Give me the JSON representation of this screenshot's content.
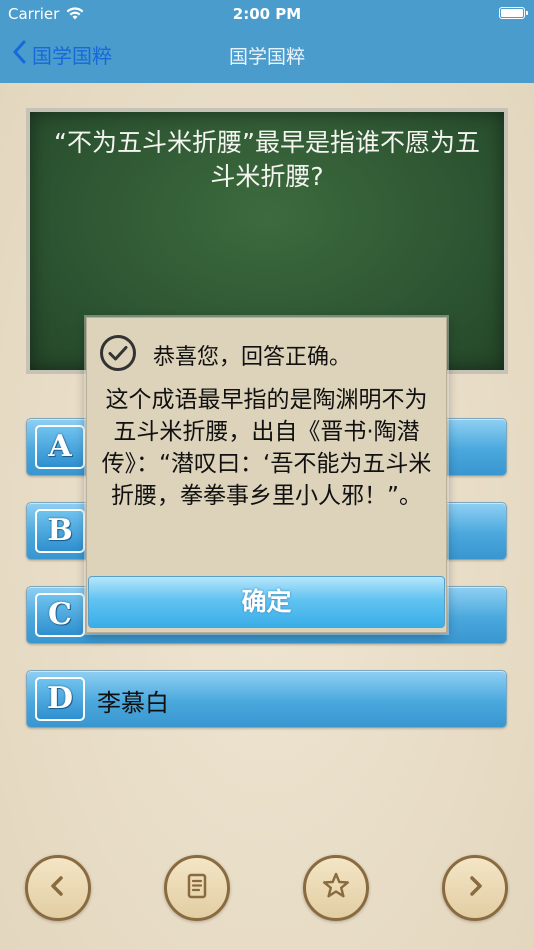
{
  "status_bar": {
    "carrier": "Carrier",
    "time": "2:00 PM"
  },
  "nav": {
    "back_label": "国学国粹",
    "title": "国学国粹"
  },
  "question": {
    "text": "“不为五斗米折腰”最早是指谁不愿为五斗米折腰?"
  },
  "options": [
    {
      "letter": "A",
      "label": ""
    },
    {
      "letter": "B",
      "label": ""
    },
    {
      "letter": "C",
      "label": ""
    },
    {
      "letter": "D",
      "label": "李慕白"
    }
  ],
  "dialog": {
    "message": "恭喜您，回答正确。",
    "explanation": "这个成语最早指的是陶渊明不为五斗米折腰，出自《晋书·陶潜传》：“潜叹曰：‘吾不能为五斗米折腰，拳拳事乡里小人邪！”。",
    "ok_label": "确定"
  },
  "toolbar": {
    "icons": [
      "previous-icon",
      "notes-icon",
      "star-icon",
      "next-icon"
    ]
  },
  "colors": {
    "nav_bg": "#4a9ccc",
    "back_link": "#1669d8",
    "board": "#2f5a32",
    "option_blue": "#4aa8dd",
    "dialog_bg": "#ddd3bb",
    "toolbar_brown": "#8a6a3f"
  }
}
